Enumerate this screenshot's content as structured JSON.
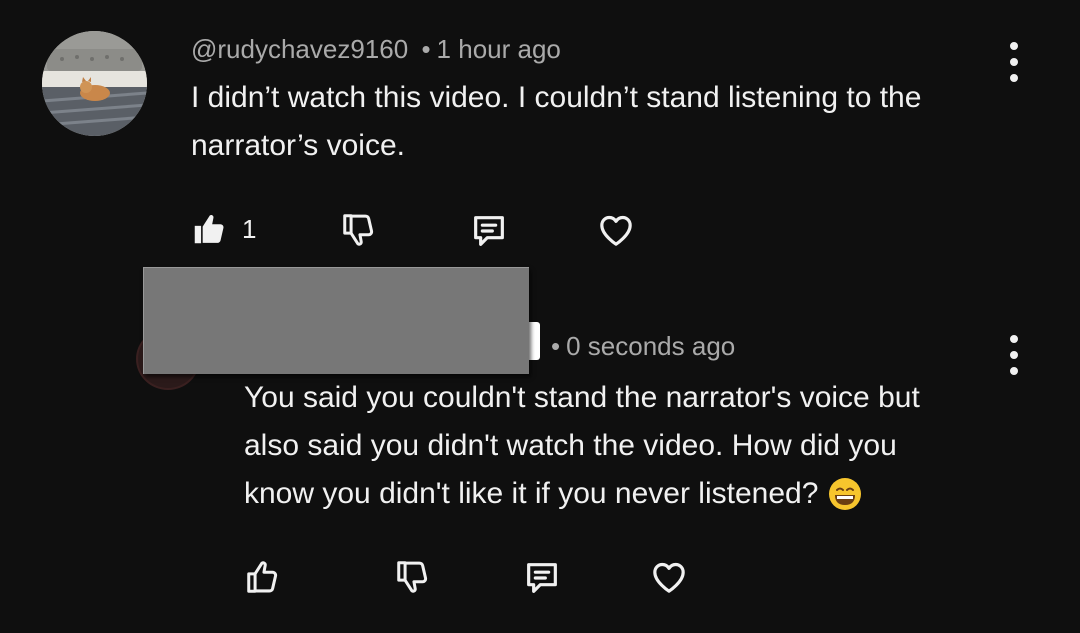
{
  "comment": {
    "author": "@rudychavez9160",
    "separator": "•",
    "time": "1 hour ago",
    "text_line1": "I didn’t watch this video. I couldn’t stand listening to the",
    "text_line2": "narrator’s voice.",
    "like_count": "1",
    "like_state": "liked",
    "avatar": "cat-photo-avatar"
  },
  "reply": {
    "author_redacted": true,
    "separator": "•",
    "time": "0 seconds ago",
    "text_line1": "You said you couldn't stand the narrator's voice but",
    "text_line2": "also said you didn't watch the video. How did you",
    "text_line3": "know you didn't like it if you never listened?",
    "emoji": "😄"
  },
  "icons": {
    "like": "thumbs-up-icon",
    "dislike": "thumbs-down-icon",
    "reply": "reply-comment-icon",
    "heart": "heart-icon",
    "more": "more-vertical-icon"
  },
  "colors": {
    "background": "#0f0f0f",
    "text": "#f1f1f1",
    "meta_text": "#aaaaaa",
    "redaction": "#777777"
  }
}
